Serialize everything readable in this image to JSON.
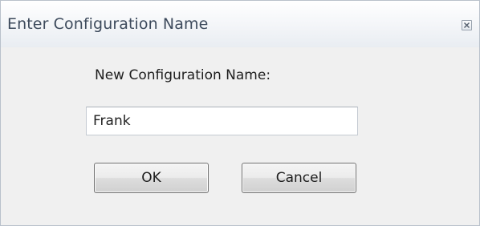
{
  "window": {
    "title": "Enter Configuration Name",
    "close_icon": "close-icon"
  },
  "form": {
    "label": "New Configuration Name:",
    "name_value": "Frank"
  },
  "buttons": {
    "ok_label": "OK",
    "cancel_label": "Cancel"
  }
}
